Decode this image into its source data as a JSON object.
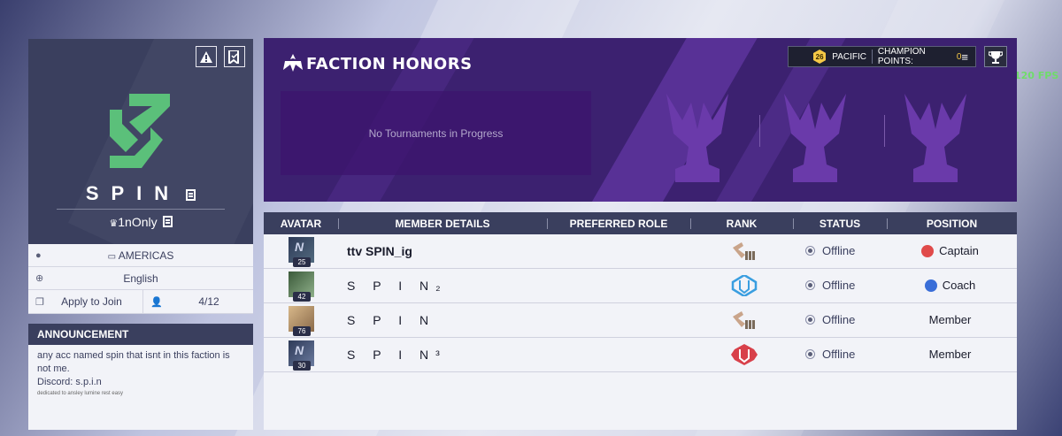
{
  "fps": "120 FPS",
  "faction": {
    "name": "SPIN",
    "owner": "1nOnly",
    "region": "AMERICAS",
    "language": "English",
    "join_label": "Apply to Join",
    "members_count": "4/12"
  },
  "announcement": {
    "header": "ANNOUNCEMENT",
    "line1": "any acc named spin that isnt in this faction is not me.",
    "line2": "Discord: s.p.i.n",
    "line3": "dedicated to ansley lumine  rest easy"
  },
  "honors": {
    "title": "FACTION HONORS",
    "tournament_text": "No Tournaments in Progress",
    "region_level": "26",
    "region": "PACIFIC",
    "champion_label": "CHAMPION POINTS:",
    "champion_points": "0"
  },
  "table": {
    "headers": [
      "AVATAR",
      "MEMBER DETAILS",
      "PREFERRED ROLE",
      "RANK",
      "STATUS",
      "POSITION"
    ],
    "rows": [
      {
        "name": "ttv SPIN_ig",
        "level": "25",
        "status": "Offline",
        "position": "Captain",
        "rank_color": "#c9a48a",
        "pos_color": "#e04a4a"
      },
      {
        "name": "S P I N₂",
        "level": "42",
        "status": "Offline",
        "position": "Coach",
        "rank_color": "#3a9ee0",
        "pos_color": "#3a6ed8"
      },
      {
        "name": "S P I N",
        "level": "76",
        "status": "Offline",
        "position": "Member",
        "rank_color": "#c9a48a",
        "pos_color": ""
      },
      {
        "name": "S P I N³",
        "level": "30",
        "status": "Offline",
        "position": "Member",
        "rank_color": "#d8404a",
        "pos_color": ""
      }
    ]
  },
  "colors": {
    "panel_dark": "#3a3f5e",
    "honors_bg": "#3c2170",
    "logo_green": "#5bc07a",
    "gold": "#f5c846"
  }
}
